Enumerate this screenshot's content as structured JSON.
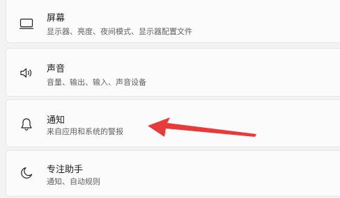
{
  "settings": {
    "items": [
      {
        "title": "屏幕",
        "subtitle": "显示器、亮度、夜间模式、显示器配置文件",
        "icon": "monitor-icon"
      },
      {
        "title": "声音",
        "subtitle": "音量、输出、输入、声音设备",
        "icon": "speaker-icon"
      },
      {
        "title": "通知",
        "subtitle": "来自应用和系统的警报",
        "icon": "bell-icon"
      },
      {
        "title": "专注助手",
        "subtitle": "通知、自动规则",
        "icon": "moon-icon"
      }
    ]
  },
  "annotation": {
    "arrow_color": "#e83a3a"
  },
  "colors": {
    "background": "#f3f3f3",
    "card": "#fbfbfb",
    "text": "#1b1b1b",
    "subtext": "#606060"
  }
}
